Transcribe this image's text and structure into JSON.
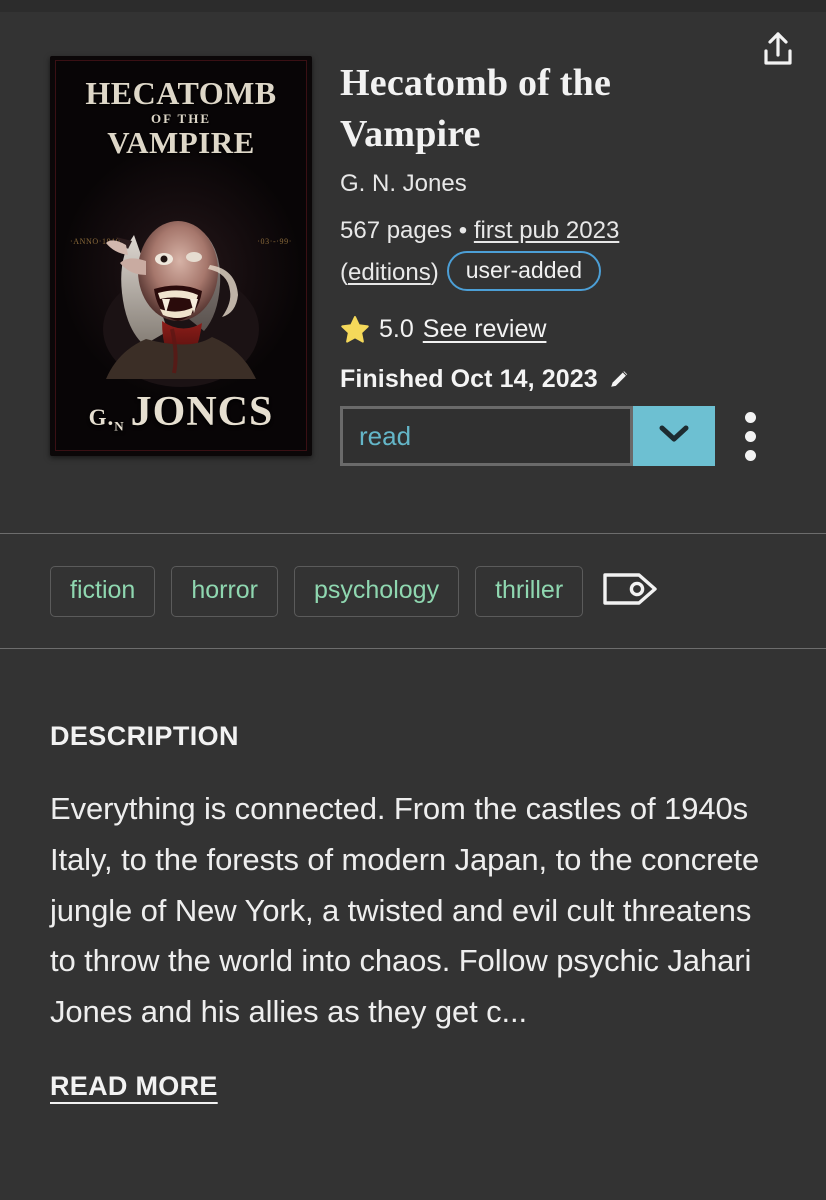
{
  "theme": {
    "page_bg": "#333333",
    "divider": "#6d6d6d",
    "accent_teal": "#6dc0d2",
    "accent_blue": "#4c9fd6",
    "tag_text": "#8fd7b0",
    "star_gold": "#f5d95a",
    "text_primary": "#f2f2f2"
  },
  "header": {
    "share_icon": "share-upload-icon"
  },
  "cover": {
    "title_line1": "HECATOMB",
    "title_line2": "OF THE",
    "title_line3": "VAMPIRE",
    "annotation_left": "·ANNO·1919·",
    "annotation_right": "·03·-·99·",
    "author_initials": "G.",
    "author_initials_sub": "N",
    "author_surname": "JONCS",
    "alt": "Hecatomb of the Vampire book cover"
  },
  "book": {
    "title": "Hecatomb of the Vampire",
    "author": "G. N. Jones",
    "pages": "567 pages",
    "separator": "•",
    "first_pub": "first pub 2023",
    "editions_open_paren": "(",
    "editions": "editions",
    "editions_close_paren": ")",
    "badge": "user-added"
  },
  "rating": {
    "star_icon": "star-icon",
    "value": "5.0",
    "see_review": "See review"
  },
  "status": {
    "finished_label": "Finished Oct 14, 2023",
    "edit_icon": "pencil-icon",
    "shelf_value": "read",
    "dropdown_icon": "chevron-down-icon",
    "more_icon": "kebab-menu-icon"
  },
  "tags": {
    "items": [
      "fiction",
      "horror",
      "psychology",
      "thriller"
    ],
    "add_icon": "tag-icon"
  },
  "description": {
    "heading": "DESCRIPTION",
    "body": "Everything is connected. From the castles of 1940s Italy, to the forests of modern Japan, to the concrete jungle of New York, a twisted and evil cult threatens to throw the world into chaos. Follow psychic Jahari Jones and his allies as they get c...",
    "read_more": "READ MORE"
  }
}
